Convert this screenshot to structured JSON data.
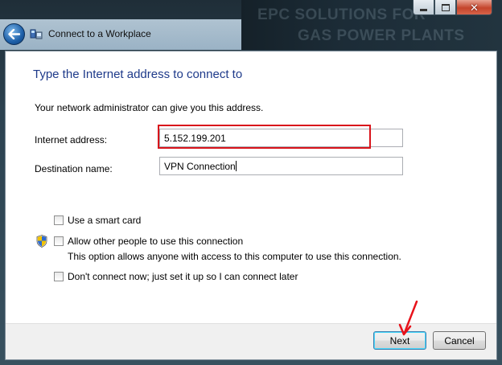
{
  "window": {
    "title": "Connect to a Workplace",
    "background_text": [
      "EPC SOLUTIONS FOR",
      "GAS POWER PLANTS"
    ]
  },
  "caption_buttons": {
    "minimize": "minimize",
    "maximize": "maximize",
    "close": "✕"
  },
  "page": {
    "heading": "Type the Internet address to connect to",
    "description": "Your network administrator can give you this address."
  },
  "form": {
    "internet_address_label": "Internet address:",
    "internet_address_value": "5.152.199.201",
    "destination_name_label": "Destination name:",
    "destination_name_value": "VPN Connection"
  },
  "options": {
    "smart_card": {
      "label": "Use a smart card",
      "checked": false
    },
    "allow_others": {
      "label": "Allow other people to use this connection",
      "note": "This option allows anyone with access to this computer to use this connection.",
      "checked": false
    },
    "dont_connect": {
      "label": "Don't connect now; just set it up so I can connect later",
      "checked": false
    }
  },
  "buttons": {
    "next": "Next",
    "cancel": "Cancel"
  },
  "colors": {
    "heading": "#1e3a8a",
    "highlight": "#d9141b",
    "annotation_arrow": "#e8121a"
  }
}
